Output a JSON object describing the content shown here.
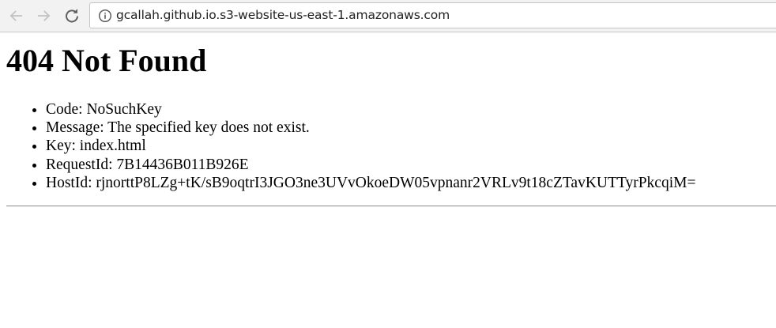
{
  "browser": {
    "url": "gcallah.github.io.s3-website-us-east-1.amazonaws.com",
    "back_icon": "arrow-left-icon",
    "forward_icon": "arrow-right-icon",
    "reload_icon": "reload-icon",
    "site_info_icon": "info-circle-icon"
  },
  "page": {
    "heading": "404 Not Found",
    "items": [
      "Code: NoSuchKey",
      "Message: The specified key does not exist.",
      "Key: index.html",
      "RequestId: 7B14436B011B926E",
      "HostId: rjnorttP8LZg+tK/sB9oqtrI3JGO3ne3UVvOkoeDW05vpnanr2VRLv9t18cZTavKUTTyrPkcqiM="
    ]
  }
}
